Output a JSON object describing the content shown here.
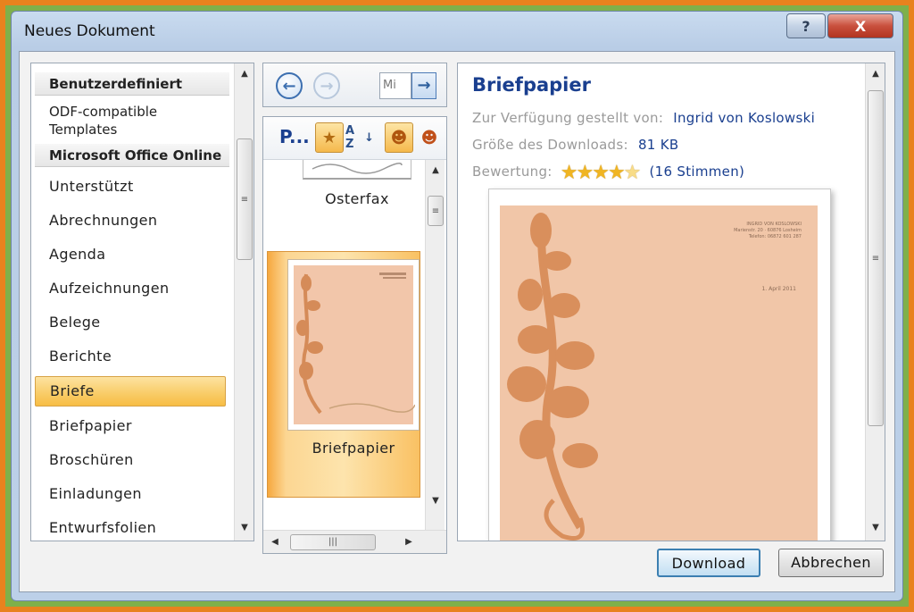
{
  "window": {
    "title": "Neues Dokument",
    "help_label": "?",
    "close_label": "X"
  },
  "categories": {
    "header_custom": "Benutzerdefiniert",
    "odf_templates": "ODF-compatible Templates",
    "header_online": "Microsoft Office Online",
    "items": [
      {
        "label": "Unterstützt"
      },
      {
        "label": "Abrechnungen"
      },
      {
        "label": "Agenda"
      },
      {
        "label": "Aufzeichnungen"
      },
      {
        "label": "Belege"
      },
      {
        "label": "Berichte"
      },
      {
        "label": "Briefe",
        "selected": true
      },
      {
        "label": "Briefpapier"
      },
      {
        "label": "Broschüren"
      },
      {
        "label": "Einladungen"
      },
      {
        "label": "Entwurfsfolien"
      }
    ]
  },
  "nav": {
    "back_icon": "arrow-left-icon",
    "forward_icon": "arrow-right-icon",
    "search_value": "Mi",
    "go_label": "→"
  },
  "templates": {
    "toolbar_label": "P...",
    "sort_label": "A Z",
    "items": [
      {
        "label": "Osterfax"
      },
      {
        "label": "Briefpapier",
        "selected": true
      }
    ]
  },
  "preview": {
    "title": "Briefpapier",
    "provided_by_label": "Zur Verfügung gestellt von:",
    "provided_by_value": "Ingrid von Koslowski",
    "size_label": "Größe des Downloads:",
    "size_value": "81 KB",
    "rating_label": "Bewertung:",
    "rating_value": 4.5,
    "rating_votes": "(16 Stimmen)",
    "doc_address_1": "INGRID VON KOSLOWSKI",
    "doc_address_2": "Marienstr. 20 · 60876 Losheim",
    "doc_address_3": "Telefon: 06872 601 287",
    "doc_date": "1. April 2011"
  },
  "buttons": {
    "download": "Download",
    "cancel": "Abbrechen"
  },
  "colors": {
    "frame_outer": "#e8821e",
    "frame_inner": "#7fb04a",
    "selection": "#f9cd6a",
    "accent_text": "#1a3f8f",
    "paper": "#f1c6a8",
    "flower": "#d98f5c"
  }
}
